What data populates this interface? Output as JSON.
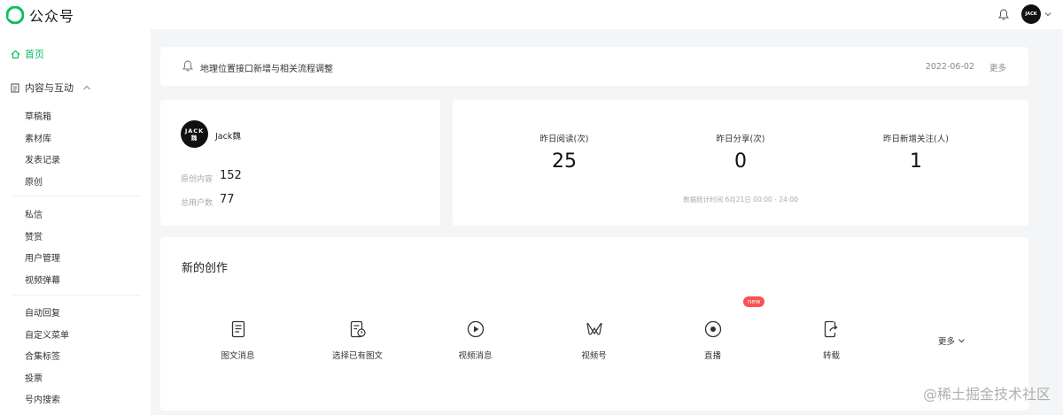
{
  "app": {
    "name": "公众号"
  },
  "sidebar": {
    "home": "首页",
    "group": "内容与互动",
    "items_a": [
      "草稿箱",
      "素材库",
      "发表记录",
      "原创"
    ],
    "items_b": [
      "私信",
      "赞赏",
      "用户管理",
      "视频弹幕"
    ],
    "items_c": [
      "自动回复",
      "自定义菜单",
      "合集标签",
      "投票",
      "号内搜索"
    ]
  },
  "notice": {
    "text": "地理位置接口新增与相关流程调整",
    "date": "2022-06-02",
    "more": "更多"
  },
  "account": {
    "avatar_text_1": "JACK",
    "avatar_text_2": "魏",
    "name": "Jack魏",
    "original_label": "原创内容",
    "original_value": "152",
    "users_label": "总用户数",
    "users_value": "77"
  },
  "metrics": {
    "items": [
      {
        "label": "昨日阅读(次)",
        "value": "25"
      },
      {
        "label": "昨日分享(次)",
        "value": "0"
      },
      {
        "label": "昨日新增关注(人)",
        "value": "1"
      }
    ],
    "period": "数据统计时间  6月21日 00:00 - 24:00"
  },
  "create": {
    "title": "新的创作",
    "tools": [
      {
        "label": "图文消息",
        "icon": "article-icon"
      },
      {
        "label": "选择已有图文",
        "icon": "article-history-icon"
      },
      {
        "label": "视频消息",
        "icon": "play-icon"
      },
      {
        "label": "视频号",
        "icon": "channels-icon"
      },
      {
        "label": "直播",
        "icon": "live-icon"
      },
      {
        "label": "转载",
        "icon": "repost-icon"
      }
    ],
    "new_badge": "new",
    "more": "更多"
  },
  "watermark": "@稀土掘金技术社区",
  "colors": {
    "accent": "#07c160",
    "badge": "#fa5151",
    "background": "#f4f5f7"
  }
}
